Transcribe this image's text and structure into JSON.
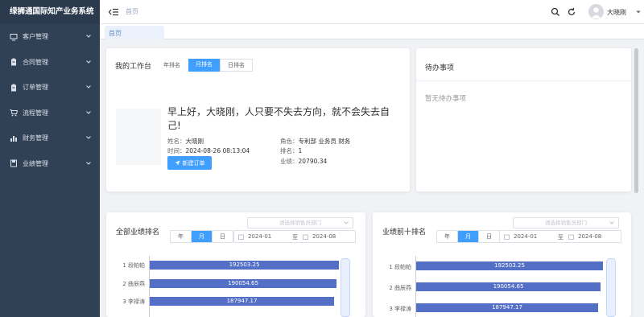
{
  "app": {
    "title": "绿狮通国际知产业务系统"
  },
  "sidebar": {
    "items": [
      {
        "label": "客户管理",
        "icon": "monitor-icon"
      },
      {
        "label": "合同管理",
        "icon": "clipboard-icon"
      },
      {
        "label": "订单管理",
        "icon": "clipboard-icon"
      },
      {
        "label": "流程管理",
        "icon": "cart-icon"
      },
      {
        "label": "财务管理",
        "icon": "chart-icon"
      },
      {
        "label": "业绩管理",
        "icon": "save-icon"
      }
    ]
  },
  "header": {
    "breadcrumb": "首页",
    "user": "大晓刚"
  },
  "tags": {
    "active": "首页"
  },
  "workbench": {
    "title": "我的工作台",
    "tabs": [
      "年排名",
      "月排名",
      "日排名"
    ],
    "active_tab": "月排名",
    "greeting": "早上好，大晓刚，人只要不失去方向，就不会失去自己!",
    "name_label": "姓名：",
    "name": "大晓刚",
    "time_label": "时间：",
    "time": "2024-08-26 08:13:04",
    "role_label": "角色：",
    "role": "专利部 业务员 财务",
    "rank_label": "排名：",
    "rank": "1",
    "perf_label": "业绩：",
    "perf": "20790.34",
    "new_order": "新建订单"
  },
  "todo": {
    "title": "待办事项",
    "empty": "暂无待办事项"
  },
  "ranking_all": {
    "title": "全部业绩排名",
    "dept_placeholder": "请选择销售员部门",
    "periods": [
      "年",
      "月",
      "日"
    ],
    "active_period": "月",
    "start": "2024-01",
    "to": "至",
    "end": "2024-08",
    "rows": [
      {
        "name": "1 段帕帕",
        "value": "192503.25"
      },
      {
        "name": "2 曲辰燕",
        "value": "190054.65"
      },
      {
        "name": "3 李禄涛",
        "value": "187947.17"
      }
    ]
  },
  "ranking_top10": {
    "title": "业绩前十排名",
    "dept_placeholder": "请选择销售员部门",
    "periods": [
      "年",
      "月",
      "日"
    ],
    "active_period": "月",
    "start": "2024-01",
    "to": "至",
    "end": "2024-08",
    "rows": [
      {
        "name": "1 段帕帕",
        "value": "192503.25"
      },
      {
        "name": "2 曲辰燕",
        "value": "190054.65"
      },
      {
        "name": "3 李禄涛",
        "value": "187947.17"
      }
    ]
  },
  "chart_data": [
    {
      "type": "bar",
      "title": "全部业绩排名",
      "categories": [
        "1 段帕帕",
        "2 曲辰燕",
        "3 李禄涛"
      ],
      "values": [
        192503.25,
        190054.65,
        187947.17
      ]
    },
    {
      "type": "bar",
      "title": "业绩前十排名",
      "categories": [
        "1 段帕帕",
        "2 曲辰燕",
        "3 李禄涛"
      ],
      "values": [
        192503.25,
        190054.65,
        187947.17
      ]
    }
  ],
  "colors": {
    "sidebar": "#304156",
    "primary": "#409eff",
    "bar": "#5470c6"
  }
}
